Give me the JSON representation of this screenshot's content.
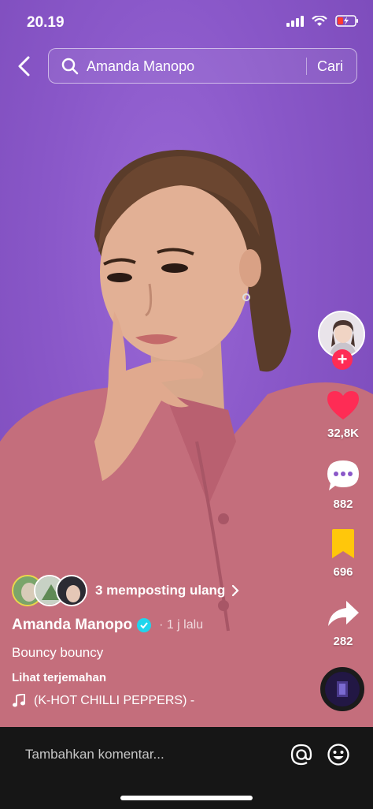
{
  "status": {
    "time": "20.19"
  },
  "search": {
    "query": "Amanda Manopo",
    "submit_label": "Cari"
  },
  "actions": {
    "likes": "32,8K",
    "comments": "882",
    "saves": "696",
    "shares": "282"
  },
  "post": {
    "reposts_label": "3 memposting ulang",
    "author": "Amanda Manopo",
    "time_ago": "· 1 j lalu",
    "caption": "Bouncy bouncy",
    "translate_label": "Lihat terjemahan",
    "music": "(K-HOT CHILLI PEPPERS) -"
  },
  "comment": {
    "placeholder": "Tambahkan komentar..."
  },
  "colors": {
    "background": "#8a58c9",
    "like": "#fe2c55",
    "save": "#ffc70b",
    "verified": "#20d5ec",
    "comment_bar": "#161616"
  }
}
